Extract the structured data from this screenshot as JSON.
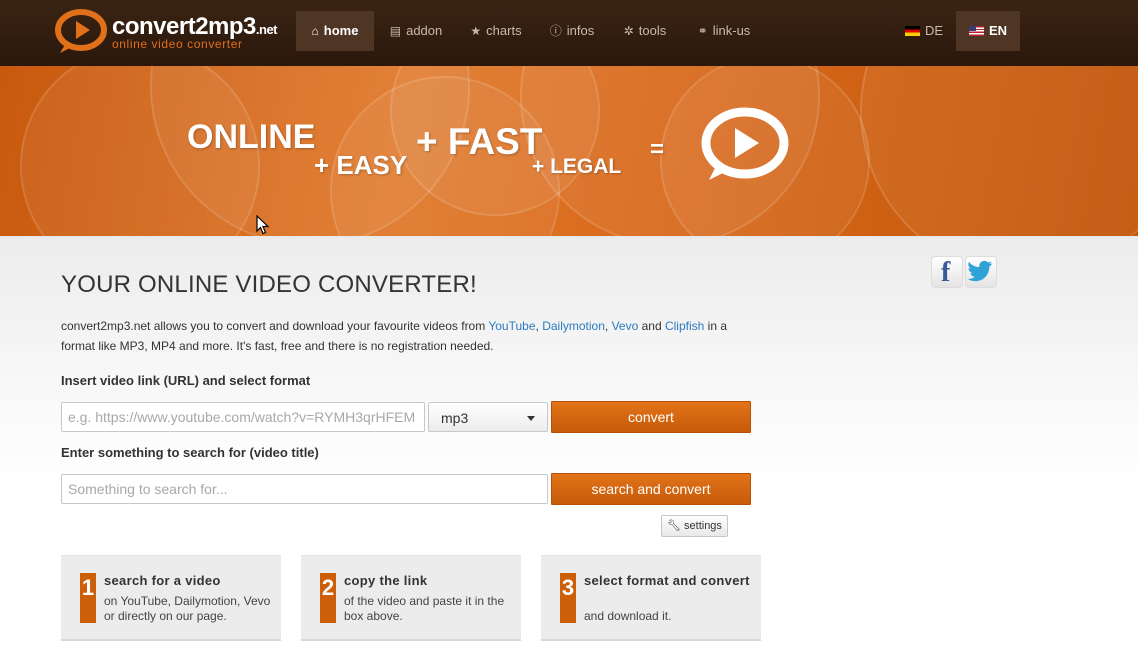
{
  "header": {
    "brand": "convert2mp3",
    "brand_tld": ".net",
    "tagline": "online video converter",
    "nav": [
      {
        "label": "home",
        "icon": "home-icon",
        "active": true
      },
      {
        "label": "addon",
        "icon": "document-icon",
        "active": false
      },
      {
        "label": "charts",
        "icon": "star-icon",
        "active": false
      },
      {
        "label": "infos",
        "icon": "info-icon",
        "active": false
      },
      {
        "label": "tools",
        "icon": "tools-icon",
        "active": false
      },
      {
        "label": "link-us",
        "icon": "link-icon",
        "active": false
      }
    ],
    "languages": [
      {
        "code": "DE",
        "flag": "de-flag-icon",
        "active": false
      },
      {
        "code": "EN",
        "flag": "us-flag-icon",
        "active": true
      }
    ]
  },
  "banner": {
    "words": [
      "ONLINE",
      "+ EASY",
      "+ FAST",
      "+ LEGAL",
      "="
    ]
  },
  "main": {
    "title": "YOUR ONLINE VIDEO CONVERTER!",
    "intro_start": "convert2mp3.net allows you to convert and download your favourite videos from ",
    "links": [
      "YouTube",
      "Dailymotion",
      "Vevo",
      "Clipfish"
    ],
    "intro_sep1": ", ",
    "intro_sep2": ", ",
    "intro_and": " and ",
    "intro_end": " in a format like MP3, MP4 and more. It's fast, free and there is no registration needed.",
    "url_label": "Insert video link (URL) and select format",
    "url_placeholder": "e.g. https://www.youtube.com/watch?v=RYMH3qrHFEM",
    "format_value": "mp3",
    "convert_label": "convert",
    "search_label": "Enter something to search for (video title)",
    "search_placeholder": "Something to search for...",
    "search_button": "search and convert",
    "settings_label": "settings"
  },
  "steps": [
    {
      "number": "1",
      "title": "search for a video",
      "text": "on YouTube, Dailymotion, Vevo or directly on our page."
    },
    {
      "number": "2",
      "title": "copy the link",
      "text": "of the video and paste it in the box above."
    },
    {
      "number": "3",
      "title": "select format and convert",
      "text": "and download it."
    }
  ],
  "colors": {
    "accent": "#cd5f0b",
    "header_bg": "#2f1c0e",
    "link": "#2a7ac0"
  }
}
